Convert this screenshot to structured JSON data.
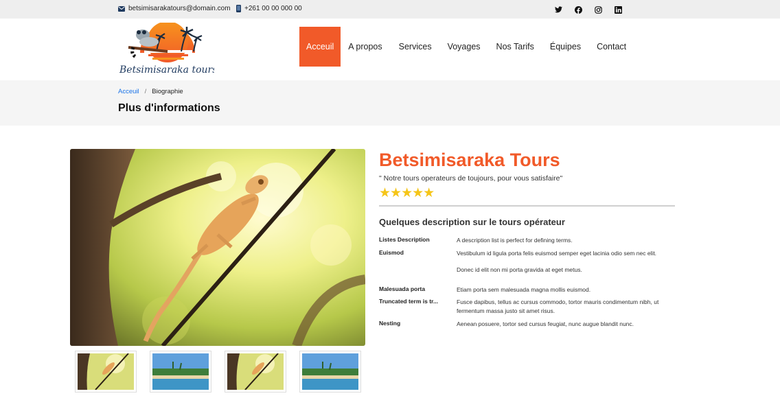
{
  "topbar": {
    "email": "betsimisarakatours@domain.com",
    "phone": "+261 00 00 000 00",
    "social": [
      "twitter-icon",
      "facebook-icon",
      "instagram-icon",
      "linkedin-icon"
    ]
  },
  "header": {
    "logo_text": "Betsimisaraka tours",
    "nav": [
      {
        "label": "Acceuil",
        "active": true
      },
      {
        "label": "A propos"
      },
      {
        "label": "Services"
      },
      {
        "label": "Voyages"
      },
      {
        "label": "Nos Tarifs"
      },
      {
        "label": "Équipes"
      },
      {
        "label": "Contact"
      }
    ]
  },
  "breadcrumb": {
    "home": "Acceuil",
    "separator": "/",
    "current": "Biographie"
  },
  "page_title": "Plus d'informations",
  "product": {
    "title": "Betsimisaraka Tours",
    "tagline": "\" Notre tours operateurs de toujours, pour vous satisfaire\"",
    "stars": "★★★★★",
    "rating": 5,
    "description_heading": "Quelques description sur le tours opérateur",
    "definitions": [
      {
        "term": "Listes Description",
        "desc": "A description list is perfect for defining terms."
      },
      {
        "term": "Euismod",
        "desc": "Vestibulum id ligula porta felis euismod semper eget lacinia odio sem nec elit."
      },
      {
        "term": "",
        "desc": "Donec id elit non mi porta gravida at eget metus."
      },
      {
        "term": "Malesuada porta",
        "desc": "Etiam porta sem malesuada magna mollis euismod."
      },
      {
        "term": "Truncated term is tr...",
        "desc": "Fusce dapibus, tellus ac cursus commodo, tortor mauris condimentum nibh, ut fermentum massa justo sit amet risus."
      },
      {
        "term": "Nesting",
        "desc": "Aenean posuere, tortor sed cursus feugiat, nunc augue blandit nunc."
      }
    ]
  },
  "gallery": {
    "thumbnails": [
      "chameleon",
      "beach",
      "chameleon",
      "beach"
    ]
  },
  "colors": {
    "accent": "#f15a29",
    "star": "#f5c518",
    "link": "#1a73e8"
  }
}
